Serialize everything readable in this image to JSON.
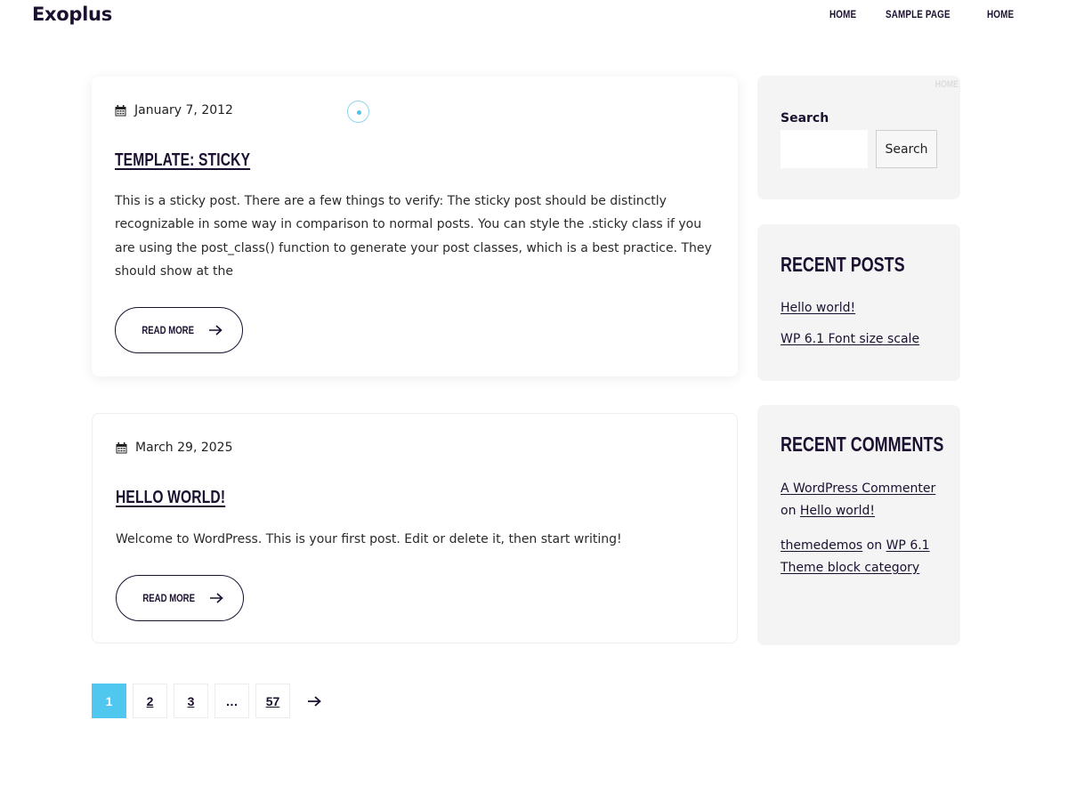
{
  "header": {
    "site_title": "Exoplus",
    "nav": [
      "HOME",
      "SAMPLE PAGE",
      "HOME"
    ]
  },
  "posts": [
    {
      "date": "January 7, 2012",
      "title": "TEMPLATE: STICKY",
      "excerpt": "This is a sticky post. There are a few things to verify: The sticky post should be distinctly recognizable in some way in comparison to normal posts. You can style the .sticky class if you are using the post_class() function to generate your post classes, which is a best practice. They should show at the",
      "read_more": "READ MORE"
    },
    {
      "date": "March 29, 2025",
      "title": "HELLO WORLD!",
      "excerpt": "Welcome to WordPress. This is your first post. Edit or delete it, then start writing!",
      "read_more": "READ MORE"
    }
  ],
  "sidebar": {
    "ghost_label": "HOME",
    "search": {
      "label": "Search",
      "input_value": "",
      "button": "Search"
    },
    "recent_posts": {
      "heading": "RECENT POSTS",
      "items": [
        "Hello world!",
        "WP 6.1 Font size scale"
      ]
    },
    "recent_comments": {
      "heading": "RECENT COMMENTS",
      "items": [
        {
          "author": "A WordPress Commenter",
          "on": "on",
          "post": "Hello world!"
        },
        {
          "author": "themedemos",
          "on": "on",
          "post": "WP 6.1 Theme block category"
        }
      ]
    }
  },
  "pagination": {
    "pages": [
      "1",
      "2",
      "3",
      "…",
      "57"
    ],
    "current": "1"
  },
  "colors": {
    "primary_text": "#1b1030",
    "accent": "#50c7ee",
    "sidebar_bg": "#f4f4f4"
  },
  "icons": {
    "date": "calendar-icon",
    "read_more": "arrow-right-icon",
    "next_page": "arrow-right-icon",
    "loading": "spinner-icon"
  }
}
